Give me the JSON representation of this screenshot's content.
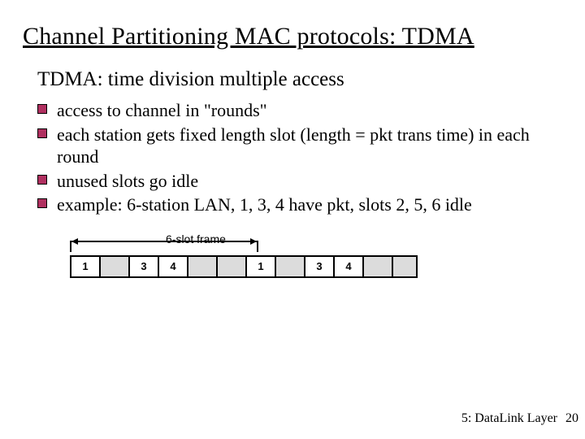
{
  "title": "Channel Partitioning MAC protocols: TDMA",
  "subtitle": "TDMA: time division multiple access",
  "bullets": [
    "access to channel in \"rounds\"",
    "each station gets fixed length slot (length = pkt trans time) in each round",
    "unused slots go idle",
    "example: 6-station LAN, 1, 3, 4 have pkt, slots 2, 5, 6 idle"
  ],
  "diagram": {
    "frame_label": "6-slot frame",
    "slots": [
      {
        "label": "1",
        "used": true
      },
      {
        "label": "",
        "used": false
      },
      {
        "label": "3",
        "used": true
      },
      {
        "label": "4",
        "used": true
      },
      {
        "label": "",
        "used": false
      },
      {
        "label": "",
        "used": false
      },
      {
        "label": "1",
        "used": true
      },
      {
        "label": "",
        "used": false
      },
      {
        "label": "3",
        "used": true
      },
      {
        "label": "4",
        "used": true
      },
      {
        "label": "",
        "used": false
      },
      {
        "label": "",
        "used": false,
        "last": true
      }
    ]
  },
  "footer": {
    "chapter": "5: DataLink Layer",
    "page": "20"
  }
}
